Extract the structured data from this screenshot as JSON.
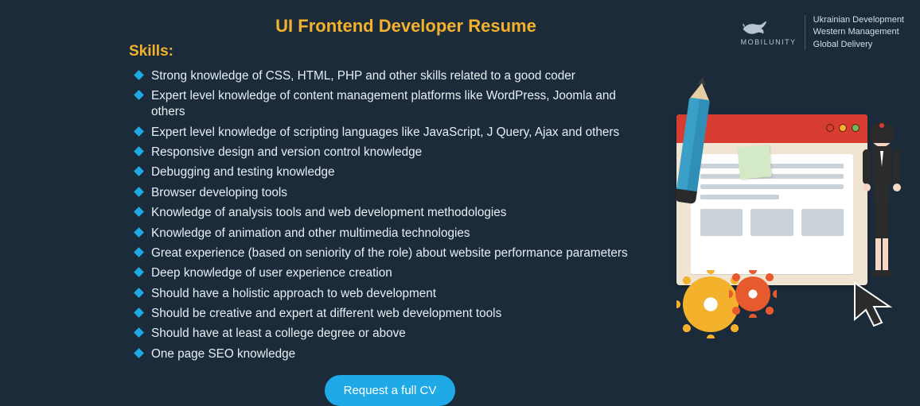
{
  "title": "UI Frontend Developer Resume",
  "skills_heading": "Skills:",
  "skills": [
    "Strong knowledge of CSS, HTML, PHP and other skills related to a good coder",
    "Expert level knowledge of content management platforms like WordPress, Joomla and others",
    "Expert level knowledge of scripting languages like JavaScript, J Query, Ajax and others",
    "Responsive design and version control knowledge",
    "Debugging and testing knowledge",
    "Browser developing tools",
    "Knowledge of analysis tools and web development methodologies",
    "Knowledge of animation and other multimedia technologies",
    "Great experience (based on seniority of the role) about website performance parameters",
    "Deep knowledge of user experience creation",
    "Should have a holistic approach to web development",
    "Should be creative and expert at different web development tools",
    "Should have at least a college degree or above",
    "One page SEO knowledge"
  ],
  "cta_label": "Request a full CV",
  "brand": {
    "name": "MOBILUNITY",
    "taglines": [
      "Ukrainian Development",
      "Western Management",
      "Global Delivery"
    ]
  },
  "colors": {
    "background": "#1b2b3a",
    "accent_yellow": "#f3b12c",
    "accent_blue": "#1fa9e6",
    "accent_red": "#d73c30",
    "accent_orange": "#e65a2e"
  }
}
